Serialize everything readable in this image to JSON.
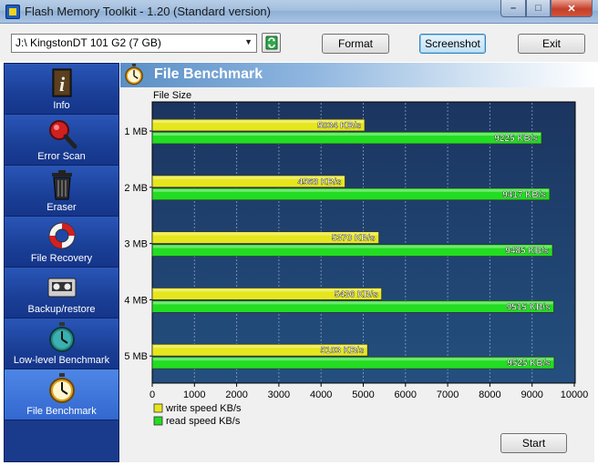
{
  "window": {
    "title": "Flash Memory Toolkit - 1.20 (Standard version)",
    "controls": {
      "minimize": "–",
      "maximize": "□",
      "close": "✕"
    }
  },
  "toolbar": {
    "drive": "J:\\ KingstonDT 101 G2 (7 GB)",
    "format_label": "Format",
    "screenshot_label": "Screenshot",
    "exit_label": "Exit"
  },
  "sidebar": {
    "items": [
      {
        "label": "Info",
        "icon": "info-icon"
      },
      {
        "label": "Error Scan",
        "icon": "magnifier-icon"
      },
      {
        "label": "Eraser",
        "icon": "trash-icon"
      },
      {
        "label": "File Recovery",
        "icon": "lifebuoy-icon"
      },
      {
        "label": "Backup/restore",
        "icon": "tape-icon"
      },
      {
        "label": "Low-level Benchmark",
        "icon": "stopwatch-icon"
      },
      {
        "label": "File Benchmark",
        "icon": "stopwatch-icon"
      }
    ],
    "active_index": 6
  },
  "panel": {
    "title": "File Benchmark",
    "start_label": "Start"
  },
  "colors": {
    "write": "#e6e61e",
    "read": "#22dd22",
    "plot_top": "#1b3560",
    "plot_bottom": "#244f7e"
  },
  "chart_data": {
    "type": "bar",
    "orientation": "horizontal",
    "ylabel": "File Size",
    "categories": [
      "1 MB",
      "2 MB",
      "3 MB",
      "4 MB",
      "5 MB"
    ],
    "series": [
      {
        "name": "write speed KB/s",
        "values": [
          5034,
          4568,
          5370,
          5436,
          5103
        ],
        "labels": [
          "5034 KB/s",
          "4568 KB/s",
          "5370 KB/s",
          "5436 KB/s",
          "5103 KB/s"
        ]
      },
      {
        "name": "read speed KB/s",
        "values": [
          9225,
          9417,
          9485,
          9515,
          9525
        ],
        "labels": [
          "9225 KB/s",
          "9417 KB/s",
          "9485 KB/s",
          "9515 KB/s",
          "9525 KB/s"
        ]
      }
    ],
    "xlim": [
      0,
      10000
    ],
    "xticks": [
      "0",
      "1000",
      "2000",
      "3000",
      "4000",
      "5000",
      "6000",
      "7000",
      "8000",
      "9000",
      "10000"
    ],
    "grid": "vertical dashed",
    "legend": "bottom-left"
  }
}
